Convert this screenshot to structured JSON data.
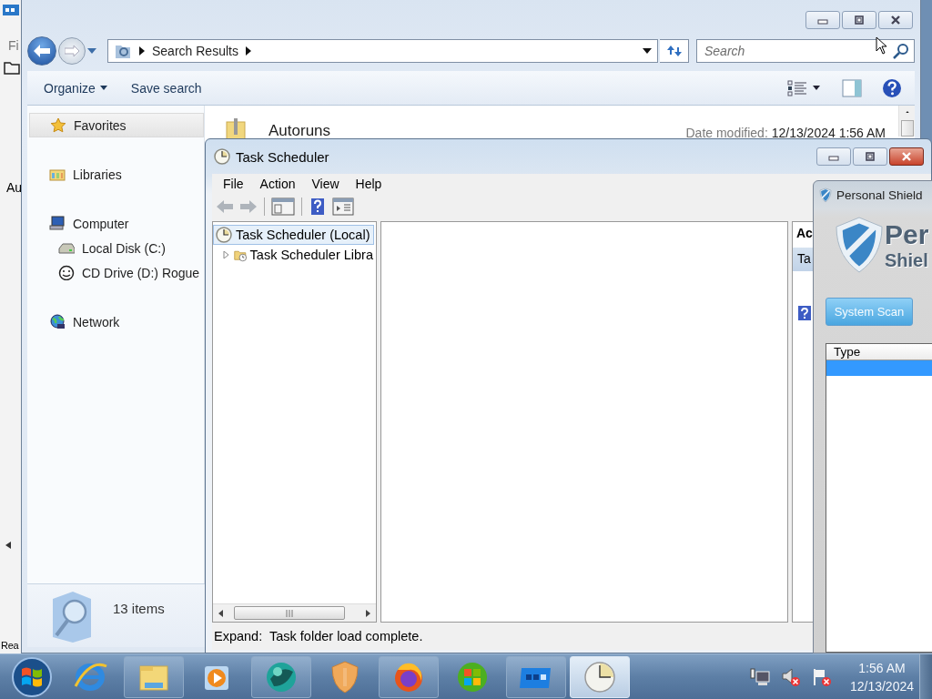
{
  "background_window": {
    "menu_label": "Fi",
    "list_label": "Au",
    "status": "Rea"
  },
  "explorer": {
    "address": {
      "crumbs": [
        "Search Results"
      ]
    },
    "search": {
      "placeholder": "Search"
    },
    "toolbar": [
      {
        "label": "Organize",
        "dropdown": true
      },
      {
        "label": "Save search",
        "dropdown": false
      }
    ],
    "nav": [
      {
        "label": "Favorites",
        "kind": "group",
        "selected": true
      },
      {
        "label": "Libraries",
        "kind": "group",
        "selected": false
      },
      {
        "label": "Computer",
        "kind": "group",
        "selected": false
      },
      {
        "label": "Local Disk (C:)",
        "kind": "child",
        "selected": false
      },
      {
        "label": "CD Drive (D:) Rogue",
        "kind": "child",
        "selected": false
      },
      {
        "label": "Network",
        "kind": "group",
        "selected": false
      }
    ],
    "files": [
      {
        "name": "Autoruns",
        "date_label": "Date modified:",
        "date": "12/13/2024 1:56 AM"
      }
    ],
    "details": {
      "count": "13 items"
    }
  },
  "task_scheduler": {
    "title": "Task Scheduler",
    "menu": [
      "File",
      "Action",
      "View",
      "Help"
    ],
    "tree": [
      {
        "label": "Task Scheduler (Local)",
        "selected": true,
        "children": [
          {
            "label": "Task Scheduler Libra",
            "selected": false,
            "expanded": false
          }
        ]
      }
    ],
    "actions_pane": {
      "title": "Ac",
      "section": "Ta"
    },
    "status": "Expand:  Task folder load complete."
  },
  "personal_shield": {
    "title": "Personal Shield",
    "logo": [
      "Per",
      "Shiel"
    ],
    "button": "System Scan",
    "table": {
      "columns": [
        "Type"
      ],
      "rows": [
        {
          "selected": true
        }
      ]
    }
  },
  "taskbar": {
    "apps": [
      {
        "running": false,
        "selected": false
      },
      {
        "running": true,
        "selected": false
      },
      {
        "running": false,
        "selected": false
      },
      {
        "running": true,
        "selected": false
      },
      {
        "running": false,
        "selected": false
      },
      {
        "running": true,
        "selected": false
      },
      {
        "running": false,
        "selected": false
      },
      {
        "running": true,
        "selected": false
      },
      {
        "running": true,
        "selected": true
      }
    ],
    "clock": {
      "time": "1:56 AM",
      "date": "12/13/2024"
    }
  }
}
